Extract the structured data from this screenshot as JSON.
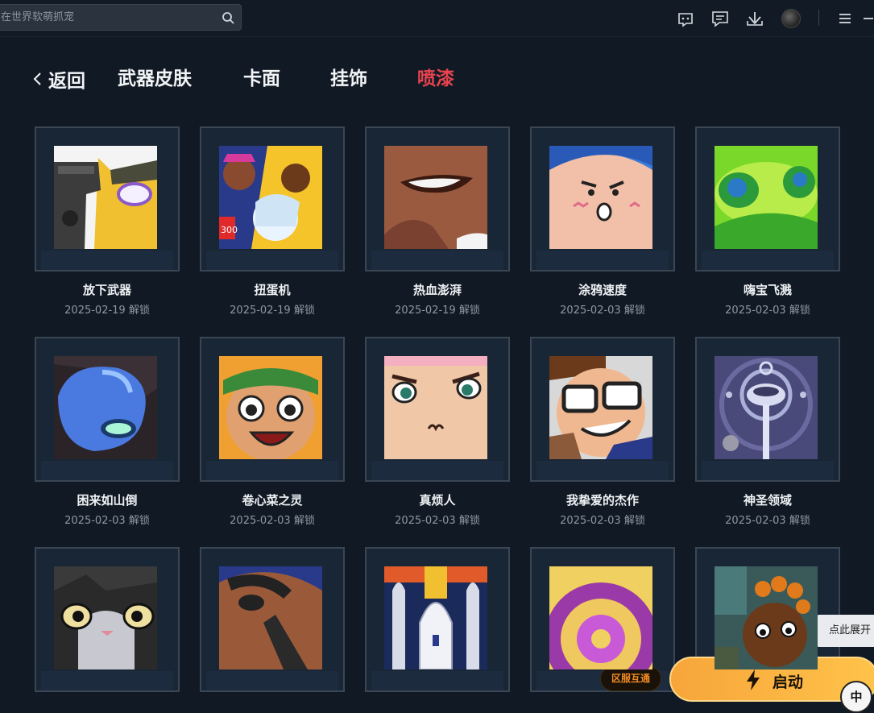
{
  "search": {
    "placeholder": "在世界软萌抓宠"
  },
  "topbar_icons": [
    "gamepad-icon",
    "message-icon",
    "download-icon",
    "avatar",
    "menu-icon",
    "minimize-icon"
  ],
  "nav": {
    "back_label": "返回",
    "tabs": [
      {
        "label": "武器皮肤",
        "active": false
      },
      {
        "label": "卡面",
        "active": false
      },
      {
        "label": "挂饰",
        "active": false
      },
      {
        "label": "喷漆",
        "active": true
      }
    ]
  },
  "colors": {
    "background": "#111a24",
    "active_tab": "#e8434f",
    "accent": "#f7a53a",
    "card_border": "#3a4654"
  },
  "sprays": [
    {
      "name": "放下武器",
      "unlocked": "2025-02-19 解锁",
      "icon": "gun-cat-spray"
    },
    {
      "name": "扭蛋机",
      "unlocked": "2025-02-19 解锁",
      "icon": "gacha-characters-spray"
    },
    {
      "name": "热血澎湃",
      "unlocked": "2025-02-19 解锁",
      "icon": "smirk-face-spray"
    },
    {
      "name": "涂鸦速度",
      "unlocked": "2025-02-03 解锁",
      "icon": "blush-face-spray"
    },
    {
      "name": "嗨宝飞溅",
      "unlocked": "2025-02-03 解锁",
      "icon": "green-slime-spray"
    },
    {
      "name": "困来如山倒",
      "unlocked": "2025-02-03 解锁",
      "icon": "blue-robot-spray"
    },
    {
      "name": "卷心菜之灵",
      "unlocked": "2025-02-03 解锁",
      "icon": "bandana-shout-spray"
    },
    {
      "name": "真烦人",
      "unlocked": "2025-02-03 解锁",
      "icon": "puffed-cheeks-spray"
    },
    {
      "name": "我挚爱的杰作",
      "unlocked": "2025-02-03 解锁",
      "icon": "glasses-guy-spray"
    },
    {
      "name": "神圣领域",
      "unlocked": "2025-02-03 解锁",
      "icon": "sacred-ring-spray"
    },
    {
      "name": "",
      "unlocked": "",
      "icon": "grumpy-cat-spray"
    },
    {
      "name": "",
      "unlocked": "",
      "icon": "bandaged-face-spray"
    },
    {
      "name": "",
      "unlocked": "",
      "icon": "rocket-spray"
    },
    {
      "name": "",
      "unlocked": "",
      "icon": "purple-swirl-spray"
    },
    {
      "name": "",
      "unlocked": "",
      "icon": "dreadlocks-agent-spray"
    }
  ],
  "tooltip": "点此展开",
  "region_badge": "区服互通",
  "launch_label": "启动",
  "lang_label": "中"
}
